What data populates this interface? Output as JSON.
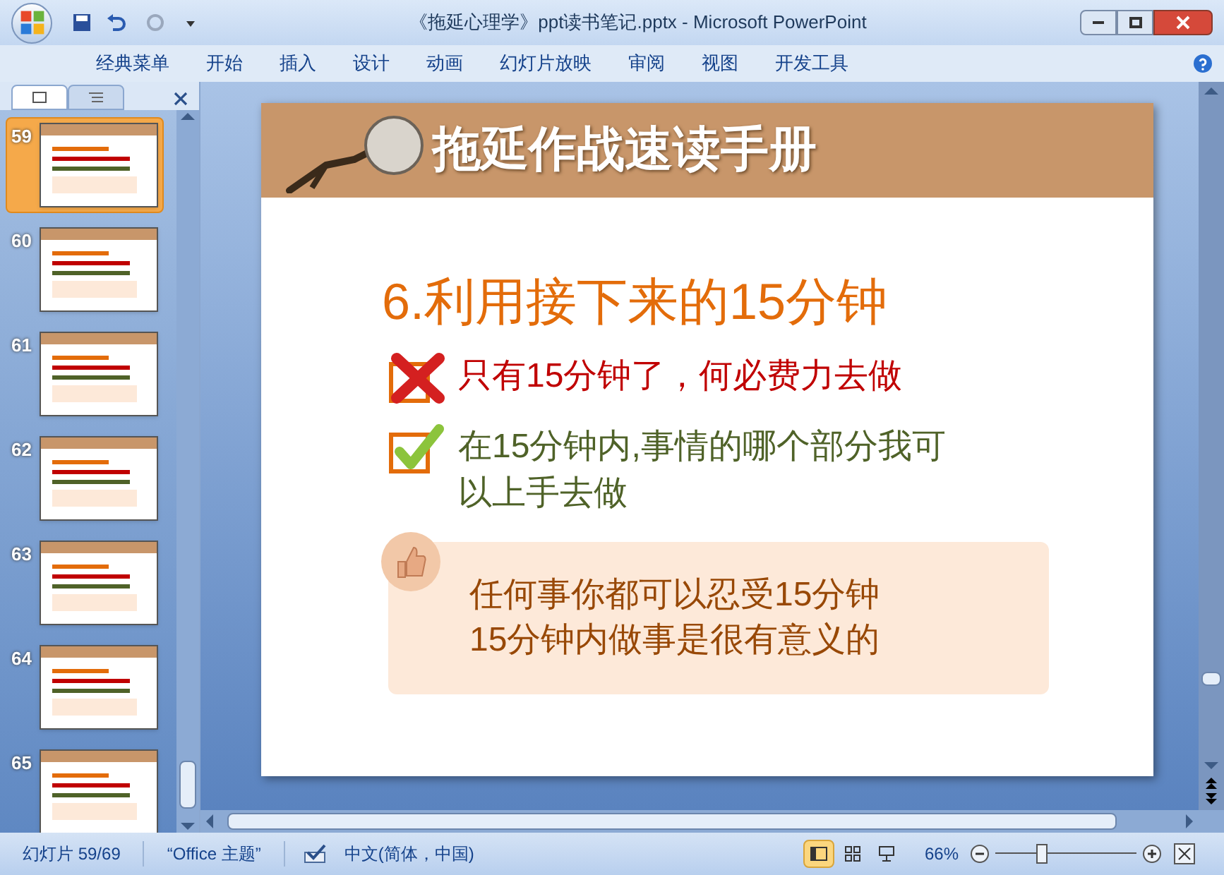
{
  "window": {
    "title": "《拖延心理学》ppt读书笔记.pptx - Microsoft PowerPoint"
  },
  "ribbon_tabs": [
    {
      "label": "经典菜单"
    },
    {
      "label": "开始"
    },
    {
      "label": "插入"
    },
    {
      "label": "设计"
    },
    {
      "label": "动画"
    },
    {
      "label": "幻灯片放映"
    },
    {
      "label": "审阅"
    },
    {
      "label": "视图"
    },
    {
      "label": "开发工具"
    }
  ],
  "panel_tabs": [
    {
      "kind": "slides",
      "selected": true
    },
    {
      "kind": "outline",
      "selected": false
    }
  ],
  "thumbnails": [
    {
      "number": "59",
      "selected": true
    },
    {
      "number": "60",
      "selected": false
    },
    {
      "number": "61",
      "selected": false
    },
    {
      "number": "62",
      "selected": false
    },
    {
      "number": "63",
      "selected": false
    },
    {
      "number": "64",
      "selected": false
    },
    {
      "number": "65",
      "selected": false
    }
  ],
  "slide": {
    "header_title": "拖延作战速读手册",
    "heading": "6.利用接下来的15分钟",
    "points": [
      {
        "kind": "cross",
        "text": "只有15分钟了，何必费力去做"
      },
      {
        "kind": "check",
        "text": "在15分钟内,事情的哪个部分我可以上手去做"
      }
    ],
    "tip": {
      "lines": [
        "任何事你都可以忍受15分钟",
        "15分钟内做事是很有意义的"
      ]
    }
  },
  "status_bar": {
    "slide_position": "幻灯片 59/69",
    "theme": "“Office 主题”",
    "language": "中文(简体，中国)",
    "views": [
      {
        "kind": "normal",
        "selected": true
      },
      {
        "kind": "sorter",
        "selected": false
      },
      {
        "kind": "show",
        "selected": false
      }
    ],
    "zoom": "66%",
    "zoom_slider": {
      "level": 0.33
    }
  }
}
